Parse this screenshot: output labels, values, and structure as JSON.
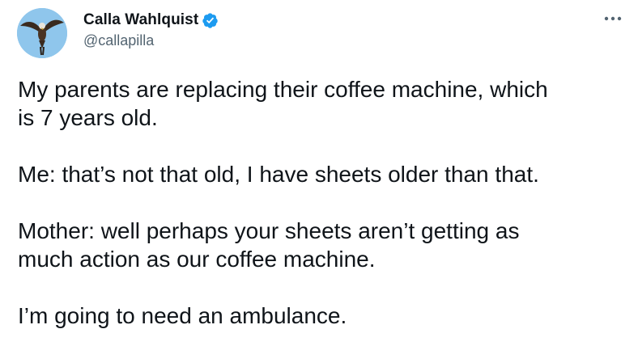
{
  "author": {
    "display_name": "Calla Wahlquist",
    "handle": "@callapilla",
    "verified": true,
    "avatar_icon": "bird-in-flight-avatar"
  },
  "actions": {
    "more_icon": "more-horizontal-icon"
  },
  "tweet": {
    "paragraphs": [
      [
        "My parents are replacing their coffee machine, which",
        "is 7 years old."
      ],
      [
        "Me: that’s not that old, I have sheets older than that."
      ],
      [
        "Mother: well perhaps your sheets aren’t getting as",
        "much action as our coffee machine."
      ],
      [
        "I’m going to need an ambulance."
      ]
    ]
  },
  "colors": {
    "text_primary": "#0f1419",
    "text_secondary": "#536471",
    "verified_blue": "#1d9bf0",
    "avatar_sky": "#8fc6ec"
  }
}
